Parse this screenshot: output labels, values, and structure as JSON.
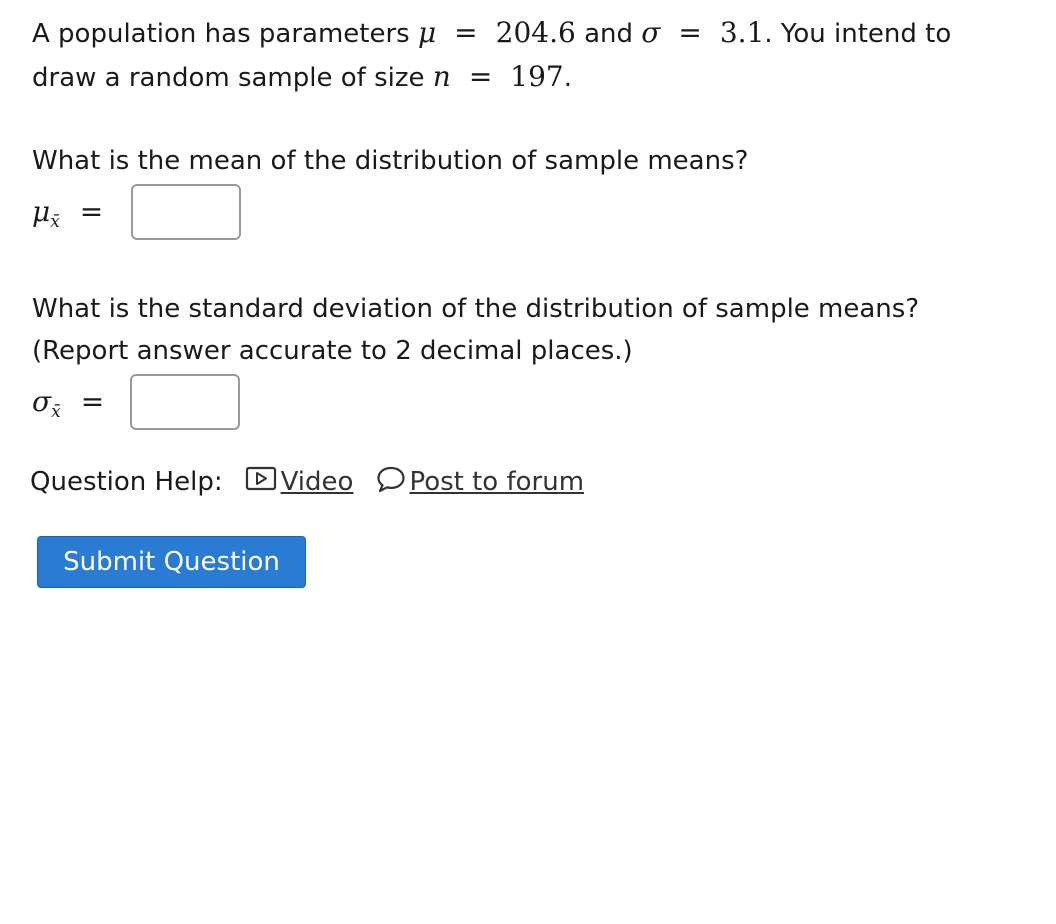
{
  "problem": {
    "intro_prefix": "A population has parameters ",
    "mu_symbol": "μ",
    "equals": "=",
    "mu_value": "204.6",
    "and_text": " and ",
    "sigma_symbol": "σ",
    "sigma_value": "3.1",
    "intro_suffix": ". You intend to",
    "line2_prefix": "draw a random sample of size ",
    "n_symbol": "n",
    "n_value": "197",
    "line2_suffix": "."
  },
  "question1": {
    "text": "What is the mean of the distribution of sample means?",
    "label_symbol": "μ",
    "label_sub": "x̄",
    "label_eq": "=",
    "input_value": ""
  },
  "question2": {
    "text_line1": "What is the standard deviation of the distribution of sample means?",
    "text_line2": "(Report answer accurate to 2 decimal places.)",
    "label_symbol": "σ",
    "label_sub": "x̄",
    "label_eq": "=",
    "input_value": ""
  },
  "help": {
    "label": "Question Help:",
    "video_label": "Video",
    "forum_label": "Post to forum",
    "video_icon": "video-play-icon",
    "forum_icon": "speech-bubble-icon"
  },
  "submit": {
    "label": "Submit Question",
    "color": "#2a7bd3"
  }
}
